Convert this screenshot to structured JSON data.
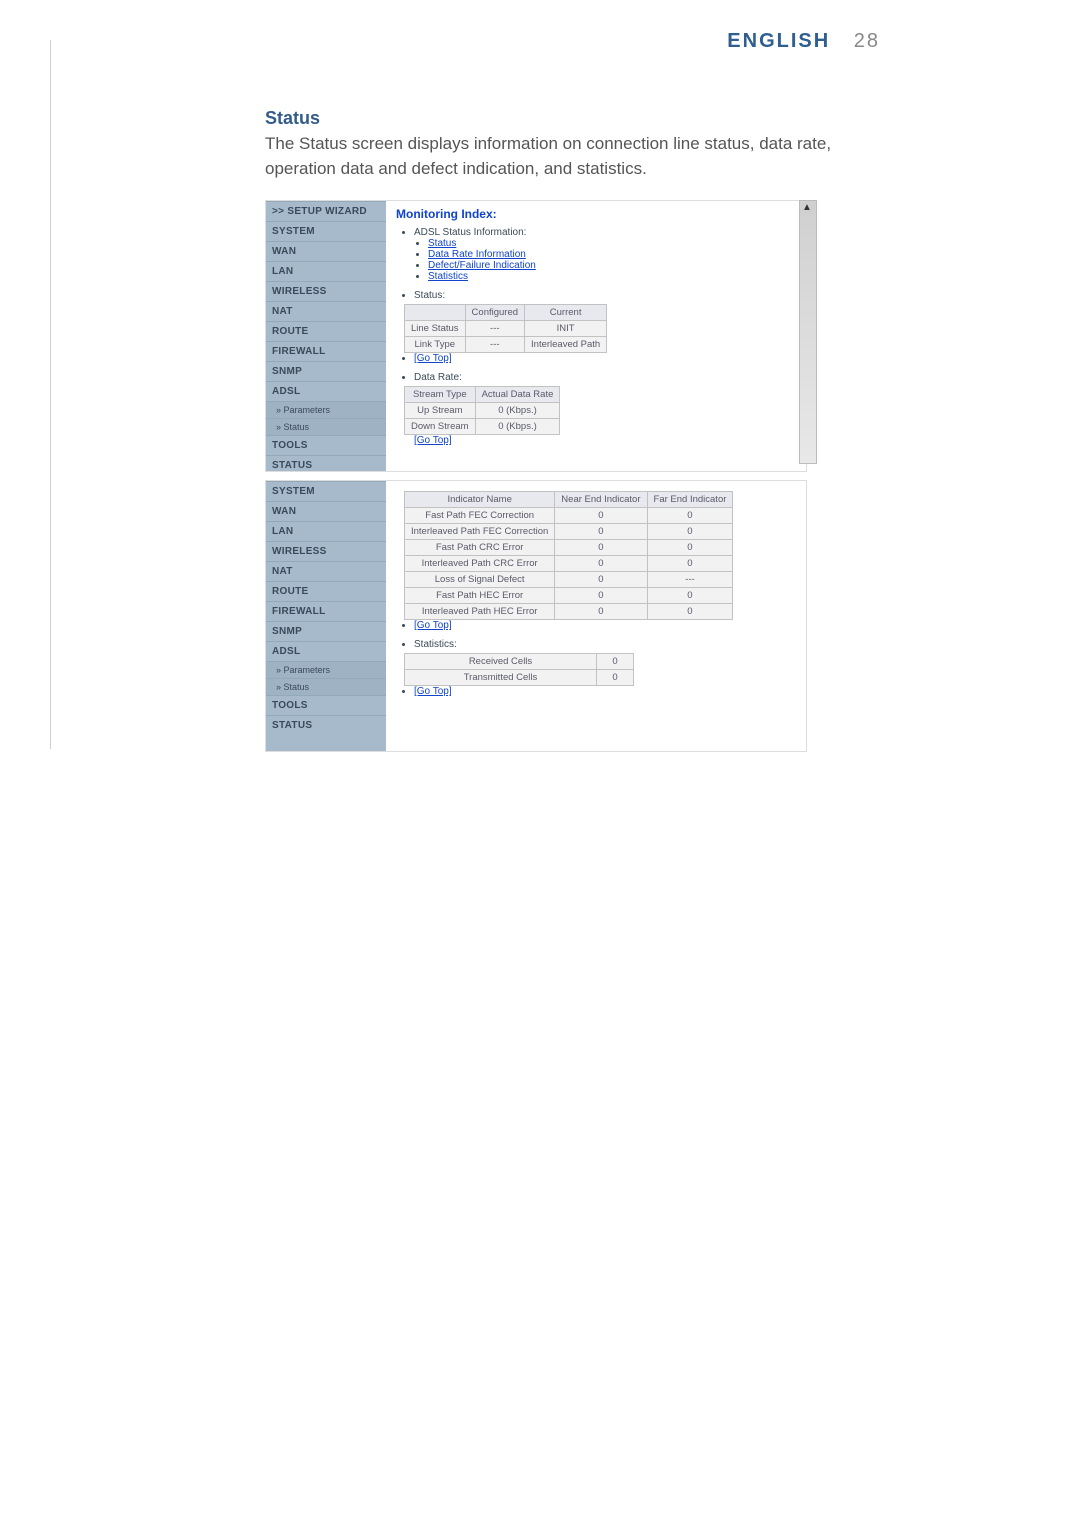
{
  "header": {
    "language": "ENGLISH",
    "page_number": "28"
  },
  "section": {
    "title": "Status",
    "body": "The Status screen displays information on connection line status, data rate, operation data and defect indication, and statistics."
  },
  "sidebar": {
    "setup_wizard": ">> SETUP WIZARD",
    "items": [
      {
        "label": "SYSTEM"
      },
      {
        "label": "WAN"
      },
      {
        "label": "LAN"
      },
      {
        "label": "WIRELESS"
      },
      {
        "label": "NAT"
      },
      {
        "label": "ROUTE"
      },
      {
        "label": "FIREWALL"
      },
      {
        "label": "SNMP"
      },
      {
        "label": "ADSL"
      }
    ],
    "subitems": [
      {
        "label": "» Parameters"
      },
      {
        "label": "» Status"
      }
    ],
    "tail": [
      {
        "label": "TOOLS"
      },
      {
        "label": "STATUS"
      }
    ]
  },
  "panel1": {
    "title": "Monitoring Index:",
    "info_heading": "ADSL Status Information:",
    "info_links": [
      "Status",
      "Data Rate Information",
      "Defect/Failure Indication",
      "Statistics"
    ],
    "status_label": "Status:",
    "status_table": {
      "headers": [
        "",
        "Configured",
        "Current"
      ],
      "rows": [
        [
          "Line Status",
          "---",
          "INIT"
        ],
        [
          "Link Type",
          "---",
          "Interleaved Path"
        ]
      ]
    },
    "gotop1": "[Go Top]",
    "rate_label": "Data Rate:",
    "rate_table": {
      "headers": [
        "Stream Type",
        "Actual Data Rate"
      ],
      "rows": [
        [
          "Up Stream",
          "0 (Kbps.)"
        ],
        [
          "Down Stream",
          "0 (Kbps.)"
        ]
      ]
    },
    "gotop2": "[Go Top]"
  },
  "panel2": {
    "ind_table": {
      "headers": [
        "Indicator Name",
        "Near End Indicator",
        "Far End Indicator"
      ],
      "rows": [
        [
          "Fast Path FEC Correction",
          "0",
          "0"
        ],
        [
          "Interleaved Path FEC Correction",
          "0",
          "0"
        ],
        [
          "Fast Path CRC Error",
          "0",
          "0"
        ],
        [
          "Interleaved Path CRC Error",
          "0",
          "0"
        ],
        [
          "Loss of Signal Defect",
          "0",
          "---"
        ],
        [
          "Fast Path HEC Error",
          "0",
          "0"
        ],
        [
          "Interleaved Path HEC Error",
          "0",
          "0"
        ]
      ]
    },
    "gotop1": "[Go Top]",
    "stats_label": "Statistics:",
    "stats_table": {
      "rows": [
        [
          "Received Cells",
          "0"
        ],
        [
          "Transmitted Cells",
          "0"
        ]
      ]
    },
    "gotop2": "[Go Top]"
  }
}
